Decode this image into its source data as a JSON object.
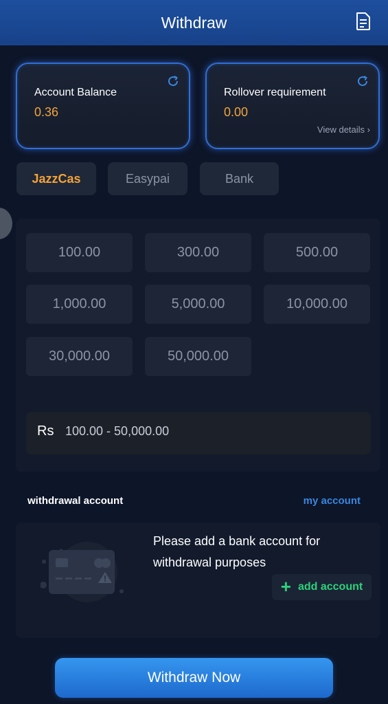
{
  "header": {
    "title": "Withdraw",
    "icon": "document-icon"
  },
  "balance_card": {
    "label": "Account Balance",
    "value": "0.36",
    "icon": "refresh-icon"
  },
  "rollover_card": {
    "label": "Rollover requirement",
    "value": "0.00",
    "link": "View details ›",
    "icon": "refresh-icon"
  },
  "methods": [
    {
      "label": "JazzCas",
      "active": true
    },
    {
      "label": "Easypai",
      "active": false
    },
    {
      "label": "Bank",
      "active": false
    }
  ],
  "amounts": [
    "100.00",
    "300.00",
    "500.00",
    "1,000.00",
    "5,000.00",
    "10,000.00",
    "30,000.00",
    "50,000.00"
  ],
  "range": {
    "currency": "Rs",
    "text": "100.00 - 50,000.00"
  },
  "withdrawal_account": {
    "title": "withdrawal account",
    "link": "my account",
    "message": "Please add a bank account for withdrawal purposes",
    "add_label": "add account"
  },
  "submit": {
    "label": "Withdraw Now"
  },
  "colors": {
    "accent_orange": "#f3a33a",
    "accent_blue": "#3a87e0",
    "accent_green": "#2ed17a",
    "header_blue": "#1d4f9e"
  }
}
